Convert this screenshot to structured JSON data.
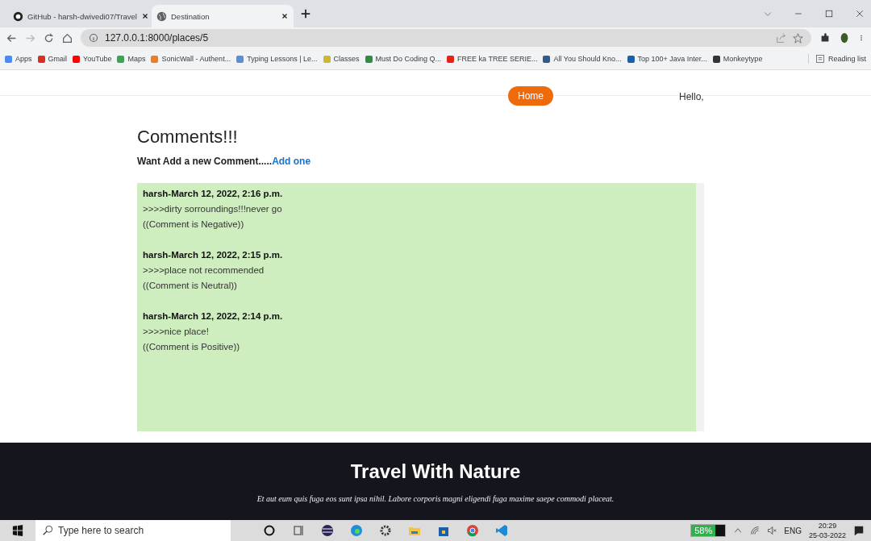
{
  "browser": {
    "tabs": [
      {
        "title": "GitHub - harsh-dwivedi07/Travel",
        "selected": false
      },
      {
        "title": "Destination",
        "selected": true
      }
    ],
    "address": "127.0.0.1:8000/places/5",
    "bookmarks": [
      {
        "label": "Apps",
        "color": "#4a8af4"
      },
      {
        "label": "Gmail",
        "color": "#d93025"
      },
      {
        "label": "YouTube",
        "color": "#ff0000"
      },
      {
        "label": "Maps",
        "color": "#34a853"
      },
      {
        "label": "SonicWall - Authent...",
        "color": "#f07c22"
      },
      {
        "label": "Typing Lessons | Le...",
        "color": "#5b8fd6"
      },
      {
        "label": "Classes",
        "color": "#c9b830"
      },
      {
        "label": "Must Do Coding Q...",
        "color": "#2f8d46"
      },
      {
        "label": "FREE ka TREE SERIE...",
        "color": "#e62117"
      },
      {
        "label": "All You Should Kno...",
        "color": "#2e5d8c"
      },
      {
        "label": "Top 100+ Java Inter...",
        "color": "#1f5fa8"
      },
      {
        "label": "Monkeytype",
        "color": "#323437"
      }
    ],
    "reading_list": "Reading list"
  },
  "nav": {
    "items": [
      {
        "label": "Home",
        "selected": true
      }
    ],
    "greeting": "Hello,"
  },
  "comments": {
    "title": "Comments!!!",
    "prompt": "Want Add a new Comment.....",
    "link": "Add one",
    "items": [
      {
        "header": "harsh-March 12, 2022, 2:16 p.m.",
        "text": ">>>>dirty sorroundings!!!never go",
        "sentiment": "((Comment is Negative))"
      },
      {
        "header": "harsh-March 12, 2022, 2:15 p.m.",
        "text": ">>>>place not recommended",
        "sentiment": "((Comment is Neutral))"
      },
      {
        "header": "harsh-March 12, 2022, 2:14 p.m.",
        "text": ">>>>nice place!",
        "sentiment": "((Comment is Positive))"
      }
    ]
  },
  "footer": {
    "title": "Travel With Nature",
    "tagline": "Et aut eum quis fuga eos sunt ipsa nihil. Labore corporis magni eligendi fuga maxime saepe commodi placeat."
  },
  "taskbar": {
    "search": {
      "placeholder": "Type here to search"
    },
    "battery": "58%",
    "language": "ENG",
    "time": "20:29",
    "date": "25-03-2022"
  }
}
